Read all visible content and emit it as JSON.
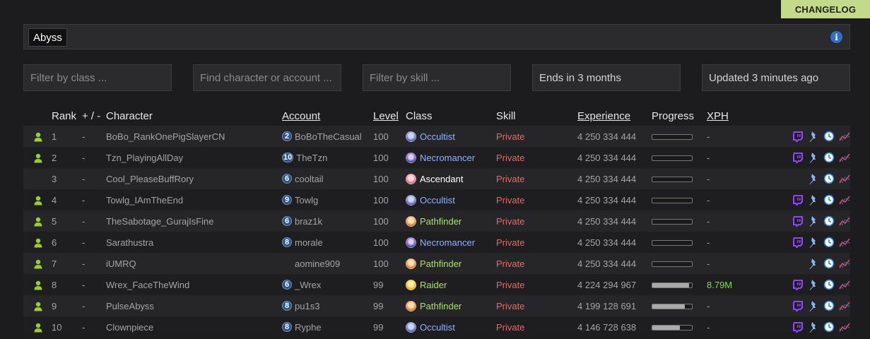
{
  "changelog_label": "CHANGELOG",
  "league": {
    "selected": "Abyss"
  },
  "filters": {
    "class_placeholder": "Filter by class ...",
    "search_placeholder": "Find character or account ...",
    "skill_placeholder": "Filter by skill ...",
    "ends_text": "Ends in 3 months",
    "updated_text": "Updated 3 minutes ago"
  },
  "columns": {
    "rank": "Rank",
    "change": "+ / -",
    "character": "Character",
    "account": "Account",
    "level": "Level",
    "class": "Class",
    "skill": "Skill",
    "experience": "Experience",
    "progress": "Progress",
    "xph": "XPH"
  },
  "colors": {
    "Occultist": "#8fb0ff",
    "Necromancer": "#8fb0ff",
    "Ascendant": "#ffffff",
    "Pathfinder": "#a8e06a",
    "Raider": "#a8e06a",
    "online": "#9acd32",
    "twitch": "#9147ff",
    "pin": "#8ab4f8",
    "clock": "#2f7fd6",
    "graph": "#d64a6a"
  },
  "rows": [
    {
      "online": true,
      "rank": "1",
      "change": "-",
      "character": "BoBo_RankOnePigSlayerCN",
      "badge": "2",
      "account": "BoBoTheCasual",
      "level": "100",
      "class": "Occultist",
      "skill": "Private",
      "experience": "4 250 334 444",
      "progress": 0,
      "xph": "-",
      "twitch": true
    },
    {
      "online": true,
      "rank": "2",
      "change": "-",
      "character": "Tzn_PlayingAllDay",
      "badge": "10",
      "account": "TheTzn",
      "level": "100",
      "class": "Necromancer",
      "skill": "Private",
      "experience": "4 250 334 444",
      "progress": 0,
      "xph": "-",
      "twitch": true
    },
    {
      "online": false,
      "rank": "3",
      "change": "-",
      "character": "Cool_PleaseBuffRory",
      "badge": "6",
      "account": "cooltail",
      "level": "100",
      "class": "Ascendant",
      "skill": "Private",
      "experience": "4 250 334 444",
      "progress": 0,
      "xph": "-",
      "twitch": false
    },
    {
      "online": true,
      "rank": "4",
      "change": "-",
      "character": "Towlg_IAmTheEnd",
      "badge": "9",
      "account": "Towlg",
      "level": "100",
      "class": "Occultist",
      "skill": "Private",
      "experience": "4 250 334 444",
      "progress": 0,
      "xph": "-",
      "twitch": true
    },
    {
      "online": true,
      "rank": "5",
      "change": "-",
      "character": "TheSabotage_GurajIsFine",
      "badge": "6",
      "account": "braz1k",
      "level": "100",
      "class": "Pathfinder",
      "skill": "Private",
      "experience": "4 250 334 444",
      "progress": 0,
      "xph": "-",
      "twitch": true
    },
    {
      "online": true,
      "rank": "6",
      "change": "-",
      "character": "Sarathustra",
      "badge": "8",
      "account": "morale",
      "level": "100",
      "class": "Necromancer",
      "skill": "Private",
      "experience": "4 250 334 444",
      "progress": 0,
      "xph": "-",
      "twitch": true
    },
    {
      "online": true,
      "rank": "7",
      "change": "-",
      "character": "iUMRQ",
      "badge": "",
      "account": "aomine909",
      "level": "100",
      "class": "Pathfinder",
      "skill": "Private",
      "experience": "4 250 334 444",
      "progress": 0,
      "xph": "-",
      "twitch": false
    },
    {
      "online": true,
      "rank": "8",
      "change": "-",
      "character": "Wrex_FaceTheWind",
      "badge": "6",
      "account": "_Wrex",
      "level": "99",
      "class": "Raider",
      "skill": "Private",
      "experience": "4 224 294 967",
      "progress": 0.92,
      "xph": "8.79M",
      "twitch": true
    },
    {
      "online": true,
      "rank": "9",
      "change": "-",
      "character": "PulseAbyss",
      "badge": "8",
      "account": "pu1s3",
      "level": "99",
      "class": "Pathfinder",
      "skill": "Private",
      "experience": "4 199 128 691",
      "progress": 0.82,
      "xph": "-",
      "twitch": true
    },
    {
      "online": true,
      "rank": "10",
      "change": "-",
      "character": "Clownpiece",
      "badge": "8",
      "account": "Ryphe",
      "level": "99",
      "class": "Occultist",
      "skill": "Private",
      "experience": "4 146 728 638",
      "progress": 0.7,
      "xph": "-",
      "twitch": true
    }
  ]
}
